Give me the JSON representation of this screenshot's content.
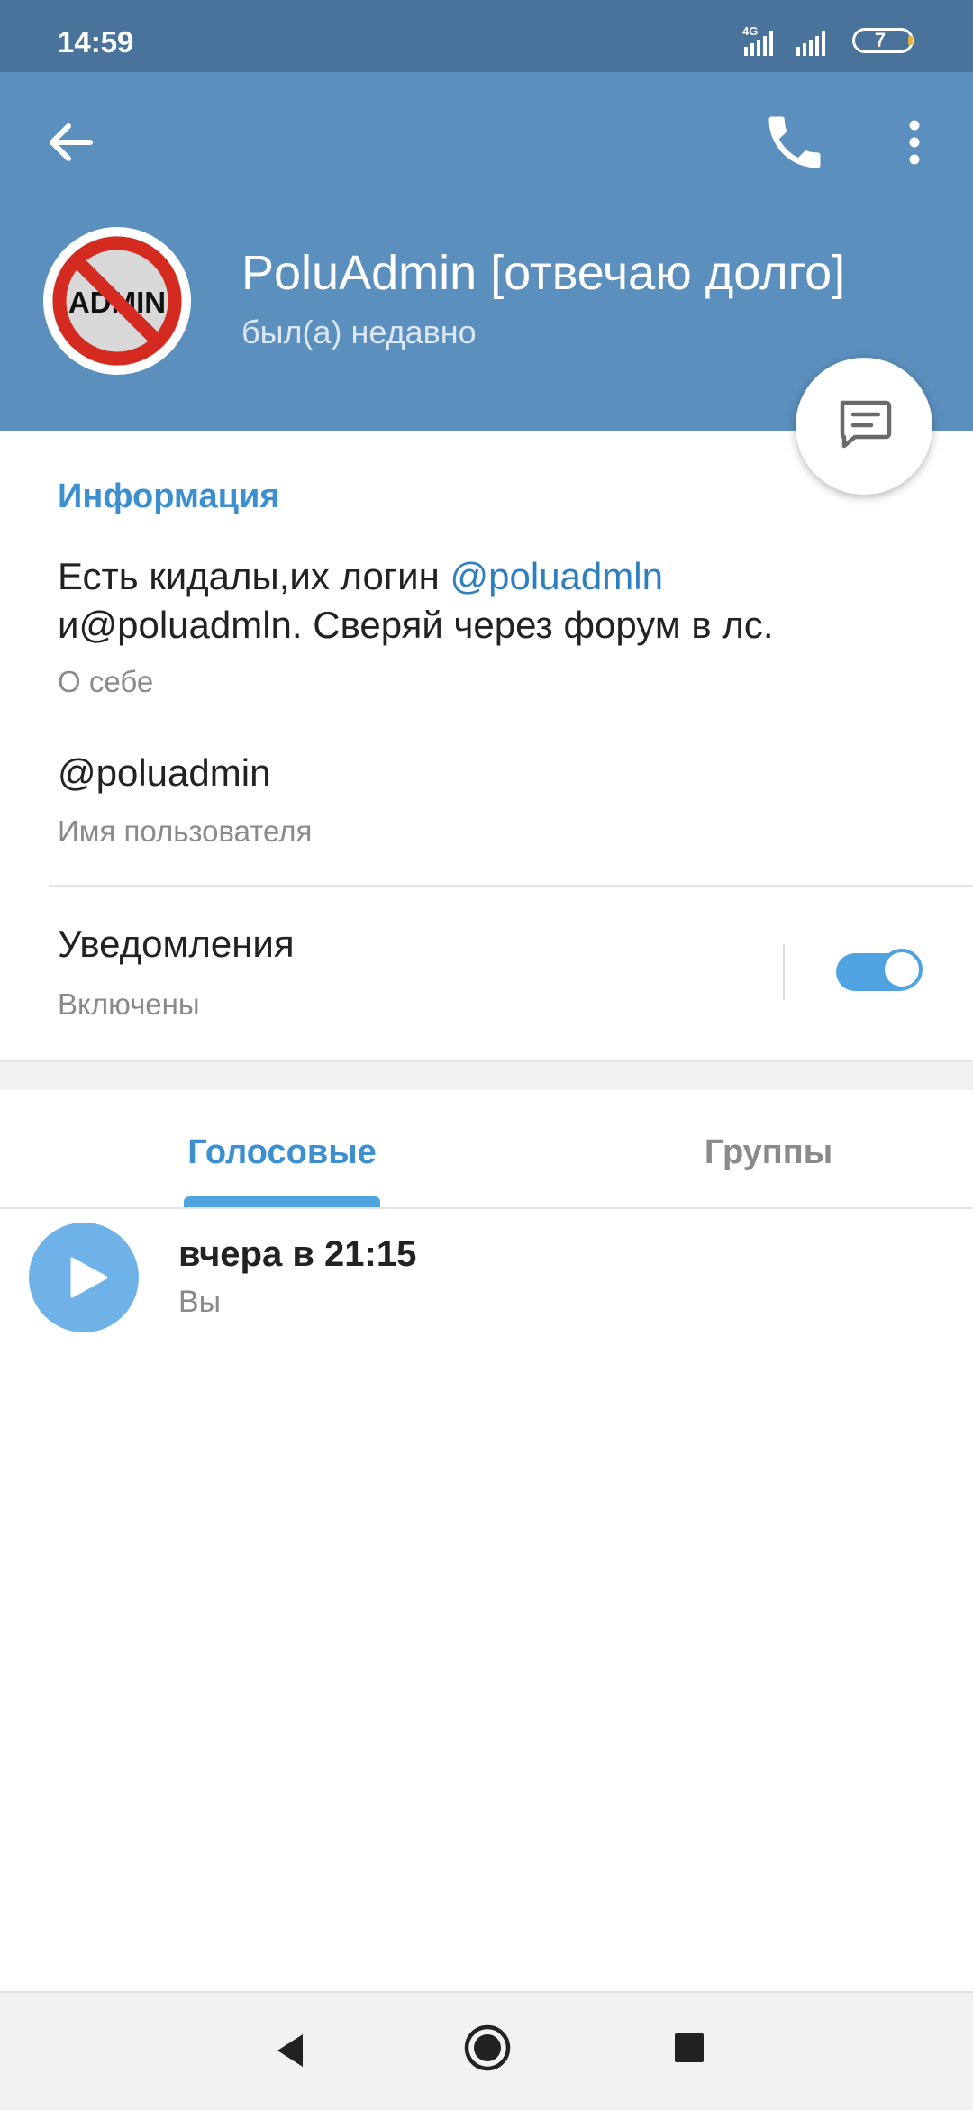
{
  "status_bar": {
    "time": "14:59",
    "network": "4G",
    "battery": "7"
  },
  "header": {
    "contact_name": "PoluAdmin [отвечаю долго]",
    "contact_status": "был(а) недавно",
    "avatar_text": "ADMIN",
    "icons": [
      "back-arrow-icon",
      "phone-icon",
      "more-vertical-icon",
      "message-icon"
    ],
    "colors": {
      "header_bg": "#5b8fbd",
      "status_bar_bg": "#4a739b",
      "accent": "#3d8fcf"
    }
  },
  "info": {
    "section_title": "Информация",
    "bio_text_prefix": "Есть кидалы,их логин ",
    "bio_link": "@poluadmln",
    "bio_text_line2": "и@poluadmln. Сверяй через форум в лс.",
    "bio_caption": "О себе",
    "username": "@poluadmin",
    "username_caption": "Имя пользователя",
    "notifications_title": "Уведомления",
    "notifications_status": "Включены",
    "notifications_enabled": true
  },
  "tabs": {
    "voice_label": "Голосовые",
    "groups_label": "Группы",
    "active": "Голосовые"
  },
  "voice_items": [
    {
      "time": "вчера в 21:15",
      "sender": "Вы"
    }
  ]
}
